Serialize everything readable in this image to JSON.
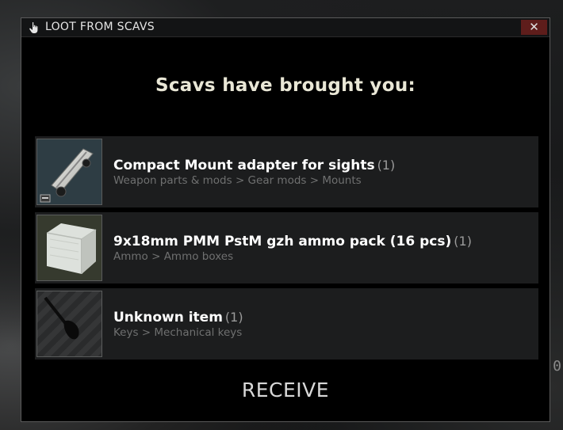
{
  "dialog": {
    "title": "LOOT FROM SCAVS",
    "title_icon": "hand-pointer-icon",
    "close_label": "✕",
    "heading": "Scavs have brought you:"
  },
  "items": [
    {
      "name": "Compact Mount adapter for sights",
      "qty": "(1)",
      "category": "Weapon parts & mods > Gear mods > Mounts",
      "icon": "mount-adapter-icon"
    },
    {
      "name": "9x18mm PMM PstM gzh ammo pack (16 pcs)",
      "qty": "(1)",
      "category": "Ammo > Ammo boxes",
      "icon": "ammo-pack-icon"
    },
    {
      "name": "Unknown item",
      "qty": "(1)",
      "category": "Keys > Mechanical keys",
      "icon": "key-silhouette-icon"
    }
  ],
  "receive_label": "RECEIVE",
  "background_fragment": "0",
  "colors": {
    "close_button": "#5e1d1b",
    "row_background": "#1c1d1e",
    "heading": "#e9e7d6"
  }
}
